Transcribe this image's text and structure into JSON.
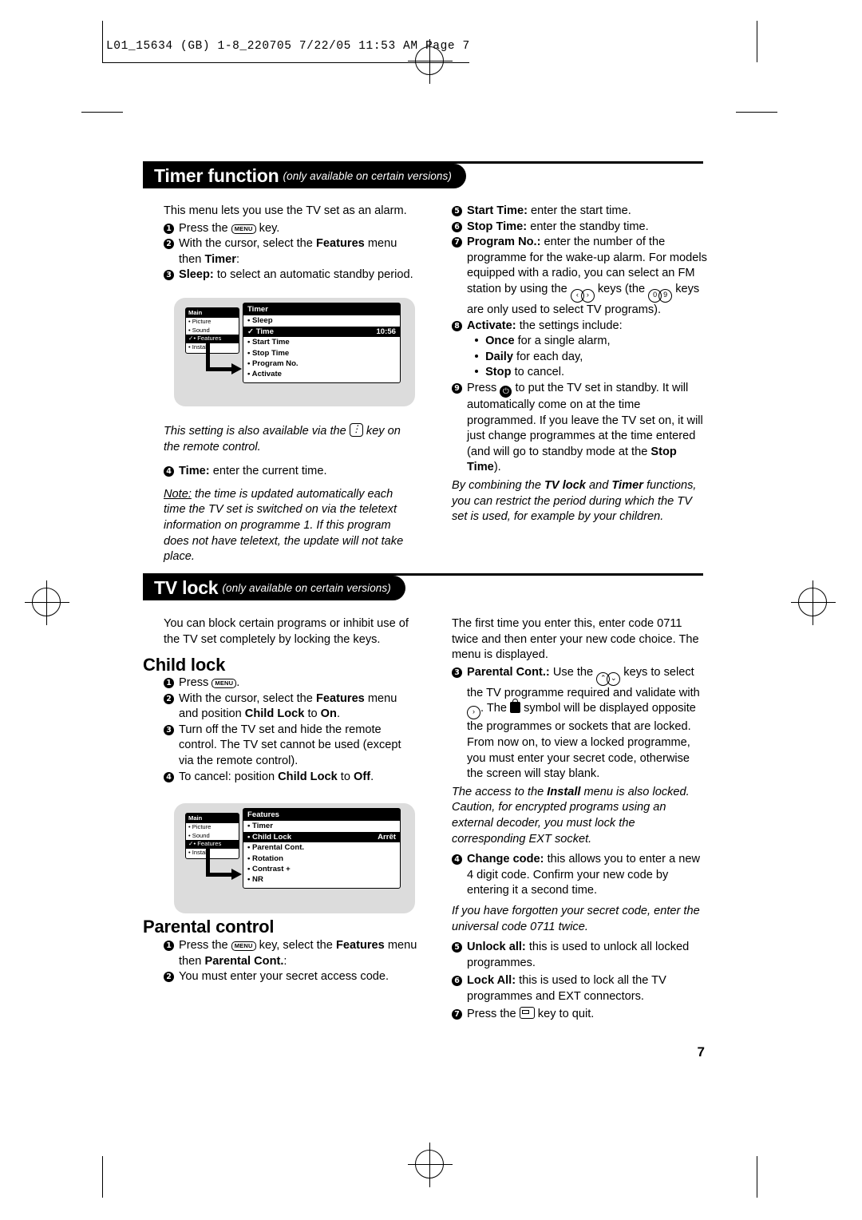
{
  "header": {
    "stamp": "L01_15634 (GB)  1-8_220705   7/22/05   11:53 AM   Page 7"
  },
  "sections": {
    "timer": {
      "title": "Timer function",
      "subtitle": "(only available on certain versions)"
    },
    "tvlock": {
      "title": "TV lock",
      "subtitle": "(only available on certain versions)"
    }
  },
  "timer_left": {
    "intro": "This menu lets you use the TV set as an alarm.",
    "item1_pre": "Press the",
    "item1_key": "MENU",
    "item1_post": "key.",
    "item2_a": "With the cursor, select the",
    "item2_b": "Features",
    "item2_c": "menu then",
    "item2_d": "Timer",
    "item2_e": ":",
    "item3_b": "Sleep:",
    "item3_t": "to select an automatic standby period.",
    "note_a": "This setting is also available via the",
    "note_b": "key on the remote control.",
    "item4_b": "Time:",
    "item4_t": "enter the current time.",
    "note2_label": "Note:",
    "note2_text": "the time is updated automatically each time the TV set is switched on via the teletext information on programme 1. If this program does not have teletext, the update will not take place."
  },
  "timer_right": {
    "item5_b": "Start Time:",
    "item5_t": "enter the start time.",
    "item6_b": "Stop Time:",
    "item6_t": "enter the standby time.",
    "item7_b": "Program No.:",
    "item7_t": "enter the number of the programme for the wake-up alarm. For models equipped with a radio, you can select an FM station by using the",
    "item7_t2": "keys (the",
    "item7_t3": "keys are only used to select TV programs).",
    "item8_b": "Activate:",
    "item8_t": "the settings include:",
    "item8_once_b": "Once",
    "item8_once_t": "for a single alarm,",
    "item8_daily_b": "Daily",
    "item8_daily_t": "for each day,",
    "item8_stop_b": "Stop",
    "item8_stop_t": "to cancel.",
    "item9_a": "Press",
    "item9_b": "to put the TV set in standby. It will automatically come on at the time programmed. If you leave the TV set on, it will just change programmes at the time entered (and will go to standby mode at the",
    "item9_c": "Stop Time",
    "item9_d": ").",
    "closing_a": "By combining the",
    "closing_b": "TV lock",
    "closing_c": "and",
    "closing_d": "Timer",
    "closing_e": "functions, you can restrict the period during which the TV set is used, for example by your children."
  },
  "osd_timer": {
    "left_header": "Main",
    "left_rows": [
      "• Picture",
      "• Sound",
      "• Features",
      "• Install"
    ],
    "left_selected_index": 2,
    "left_selected_prefix": "✓",
    "right_header": "Timer",
    "right_rows": [
      {
        "label": "• Sleep",
        "value": ""
      },
      {
        "label": "✓ Time",
        "value": "10:56"
      },
      {
        "label": "• Start Time",
        "value": ""
      },
      {
        "label": "• Stop Time",
        "value": ""
      },
      {
        "label": "• Program No.",
        "value": ""
      },
      {
        "label": "• Activate",
        "value": ""
      }
    ],
    "right_selected_index": 1
  },
  "osd_features": {
    "left_header": "Main",
    "left_rows": [
      "• Picture",
      "• Sound",
      "• Features",
      "• Install"
    ],
    "left_selected_index": 2,
    "left_selected_prefix": "✓",
    "right_header": "Features",
    "right_rows": [
      {
        "label": "• Timer",
        "value": ""
      },
      {
        "label": "• Child Lock",
        "value": "Arrêt"
      },
      {
        "label": "• Parental Cont.",
        "value": ""
      },
      {
        "label": "• Rotation",
        "value": ""
      },
      {
        "label": "• Contrast +",
        "value": ""
      },
      {
        "label": "• NR",
        "value": ""
      }
    ],
    "right_selected_index": 1
  },
  "tvlock_left": {
    "intro": "You can block certain programs or inhibit use of the TV set completely by locking the keys.",
    "childlock_head": "Child lock",
    "c1_pre": "Press",
    "c1_key": "MENU",
    "c1_post": ".",
    "c2_a": "With the cursor, select the",
    "c2_b": "Features",
    "c2_c": "menu and position",
    "c2_d": "Child Lock",
    "c2_e": "to",
    "c2_f": "On",
    "c2_g": ".",
    "c3": "Turn off the TV set and hide the remote control. The TV set cannot be used (except via the remote control).",
    "c4_a": "To cancel: position",
    "c4_b": "Child Lock",
    "c4_c": "to",
    "c4_d": "Off",
    "c4_e": ".",
    "parental_head": "Parental control",
    "p1_a": "Press the",
    "p1_key": "MENU",
    "p1_b": "key, select the",
    "p1_c": "Features",
    "p1_d": "menu then",
    "p1_e": "Parental Cont.",
    "p1_f": ":",
    "p2": "You must enter your secret access code."
  },
  "tvlock_right": {
    "intro": "The first time you enter this, enter code 0711 twice and then enter your new code choice. The menu is displayed.",
    "r3_b": "Parental Cont.:",
    "r3_t1": "Use the",
    "r3_t2": "keys to select the TV programme required and validate with",
    "r3_t3": ". The",
    "r3_t4": "symbol will be displayed opposite the programmes or sockets that are locked. From now on, to view a locked programme, you must enter your secret code, otherwise the screen will stay blank.",
    "r3_ital_a": "The access to the",
    "r3_ital_b": "Install",
    "r3_ital_c": "menu is also locked. Caution, for encrypted programs using an external decoder, you must lock the corresponding EXT socket.",
    "r4_b": "Change code:",
    "r4_t": "this allows you to enter a new 4 digit code. Confirm your new code by entering it a second time.",
    "r4_ital": "If you have forgotten your secret code, enter the universal code 0711 twice.",
    "r5_b": "Unlock all:",
    "r5_t": "this is used to unlock all locked programmes.",
    "r6_b": "Lock All:",
    "r6_t": "this is used to lock all the TV programmes and EXT connectors.",
    "r7_a": "Press the",
    "r7_b": "key to quit."
  },
  "footer": {
    "page_number": "7"
  }
}
